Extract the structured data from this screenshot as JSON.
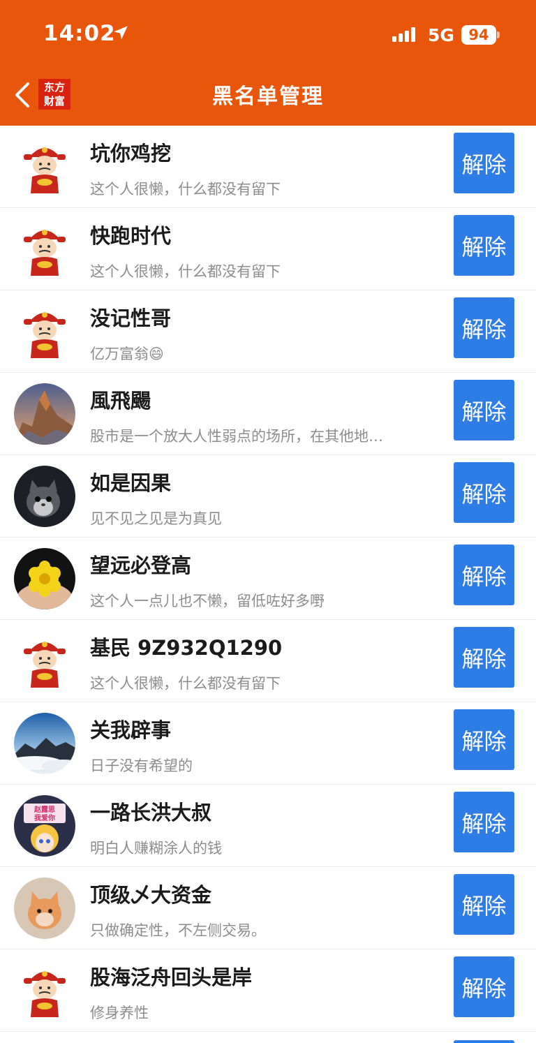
{
  "status_bar": {
    "time": "14:02",
    "network": "5G",
    "battery": "94"
  },
  "nav": {
    "title": "黑名单管理",
    "logo_line1": "东方",
    "logo_line2": "财富"
  },
  "unblock_label": "解除",
  "users": [
    {
      "name": "坑你鸡挖",
      "desc": "这个人很懒，什么都没有留下",
      "avatar": "caishen"
    },
    {
      "name": "快跑时代",
      "desc": "这个人很懒，什么都没有留下",
      "avatar": "caishen"
    },
    {
      "name": "没记性哥",
      "desc": "亿万富翁😄",
      "avatar": "caishen"
    },
    {
      "name": "風飛颺",
      "desc": "股市是一个放大人性弱点的场所，在其他地…",
      "avatar": "mountain-peak"
    },
    {
      "name": "如是因果",
      "desc": "见不见之见是为真见",
      "avatar": "cat"
    },
    {
      "name": "望远必登高",
      "desc": "这个人一点儿也不懒，留低咗好多嘢",
      "avatar": "yellow-flower"
    },
    {
      "name": "基民 9Z932Q1290",
      "desc": "这个人很懒，什么都没有留下",
      "avatar": "caishen"
    },
    {
      "name": "关我辟事",
      "desc": "日子没有希望的",
      "avatar": "sea-of-clouds"
    },
    {
      "name": "一路长洪大叔",
      "desc": "明白人赚糊涂人的钱",
      "avatar": "cartoon-girl"
    },
    {
      "name": "顶级乄大资金",
      "desc": "只做确定性，不左侧交易。",
      "avatar": "kitten"
    },
    {
      "name": "股海泛舟回头是岸",
      "desc": "修身养性",
      "avatar": "caishen"
    }
  ],
  "colors": {
    "header": "#E8560C",
    "button": "#2E7CE6",
    "logo": "#D9230F"
  }
}
